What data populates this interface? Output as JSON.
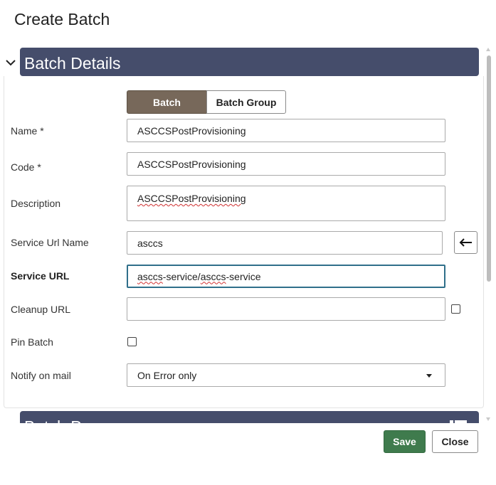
{
  "dialog": {
    "title": "Create Batch"
  },
  "sections": {
    "batch_details": {
      "title": "Batch Details"
    },
    "next_section": {
      "title": "Batch P"
    }
  },
  "batch_type": {
    "options": [
      "Batch",
      "Batch Group"
    ],
    "selected": "Batch"
  },
  "fields": {
    "name": {
      "label": "Name *",
      "value": "ASCCSPostProvisioning"
    },
    "code": {
      "label": "Code *",
      "value": "ASCCSPostProvisioning"
    },
    "description": {
      "label": "Description",
      "value": "ASCCSPostProvisioning"
    },
    "service_url_name": {
      "label": "Service Url Name",
      "value": "asccs"
    },
    "service_url": {
      "label": "Service URL",
      "value_part1": "asccs",
      "value_part2": "-service/",
      "value_part3": "asccs",
      "value_part4": "-service"
    },
    "cleanup_url": {
      "label": "Cleanup URL",
      "value": "",
      "checked": false
    },
    "pin_batch": {
      "label": "Pin Batch",
      "checked": false
    },
    "notify_on_mail": {
      "label": "Notify on mail",
      "selected": "On Error only"
    }
  },
  "buttons": {
    "save": "Save",
    "close": "Close"
  },
  "icons": {
    "chevron": "chevron-down-icon",
    "back_arrow": "arrow-left-icon",
    "section_icon": "table-icon"
  },
  "colors": {
    "section_header_bg": "#454d6b",
    "segment_selected_bg": "#77685a",
    "save_bg": "#3f7b4d",
    "focus_border": "#2f6f8a"
  }
}
